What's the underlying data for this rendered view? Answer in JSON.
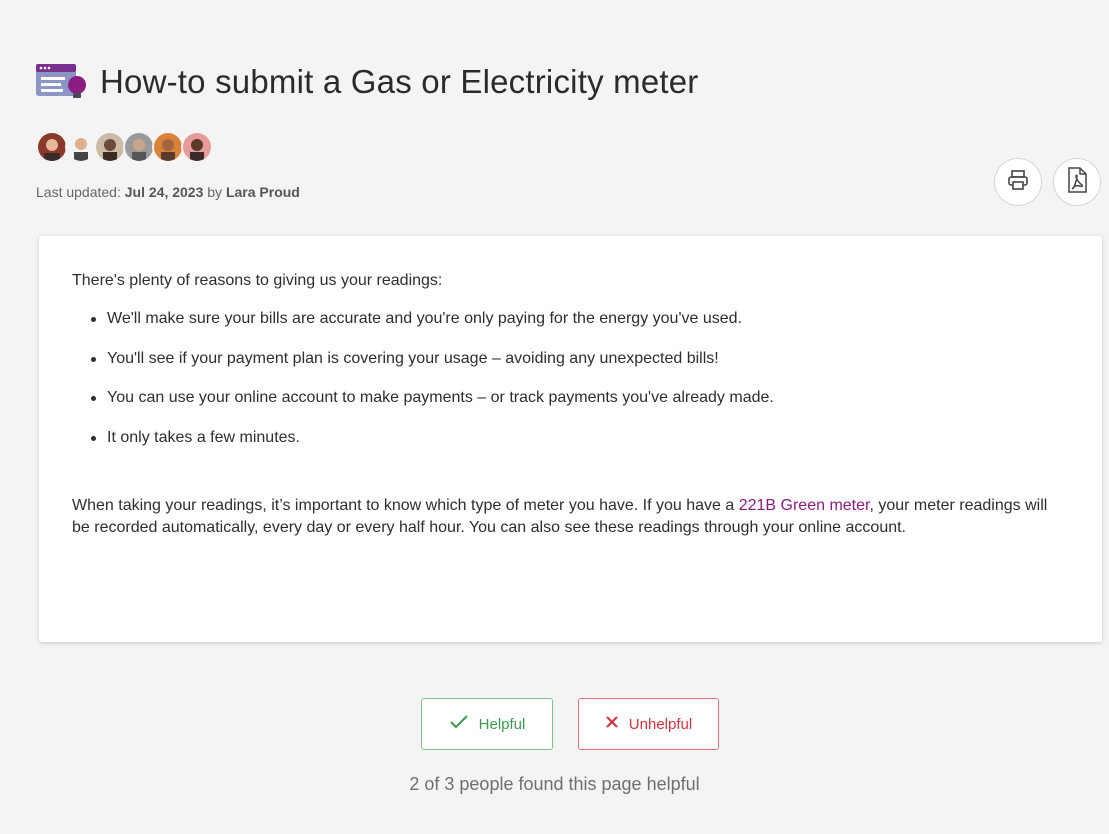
{
  "article": {
    "title": "How-to submit a Gas or Electricity meter",
    "updated_label": "Last updated:",
    "updated_date": "Jul 24, 2023",
    "by_label": "by",
    "author": "Lara Proud"
  },
  "contributors": [
    {
      "name": "contributor-1",
      "color": "#8a3a2a"
    },
    {
      "name": "contributor-2",
      "color": "#c9a27a"
    },
    {
      "name": "contributor-3",
      "color": "#6b4a3a"
    },
    {
      "name": "contributor-4",
      "color": "#707070"
    },
    {
      "name": "contributor-5",
      "color": "#b35a20"
    },
    {
      "name": "contributor-6",
      "color": "#d47a7a"
    }
  ],
  "actions": {
    "print_icon": "print-icon",
    "pdf_icon": "pdf-icon"
  },
  "content": {
    "intro": "There's plenty of reasons to giving us your readings:",
    "bullets": [
      "We'll make sure your bills are accurate and you're only paying for the energy you've used.",
      "You'll see if your payment plan is covering your usage – avoiding any unexpected bills!",
      "You can use your online account to make payments – or track payments you've already made.",
      "It only takes a few minutes."
    ],
    "para2_before": "When taking your readings, it’s important to know which type of meter you have. If you have a ",
    "para2_link": "221B Green meter",
    "para2_after": ", your meter readings will be recorded automatically, every day or every half hour. You can also see these readings through your online account."
  },
  "feedback": {
    "helpful_label": "Helpful",
    "unhelpful_label": "Unhelpful",
    "summary": "2 of 3 people found this page helpful"
  },
  "colors": {
    "accent": "#8b1d82",
    "helpful": "#3d9a4f",
    "unhelpful": "#d53340"
  }
}
